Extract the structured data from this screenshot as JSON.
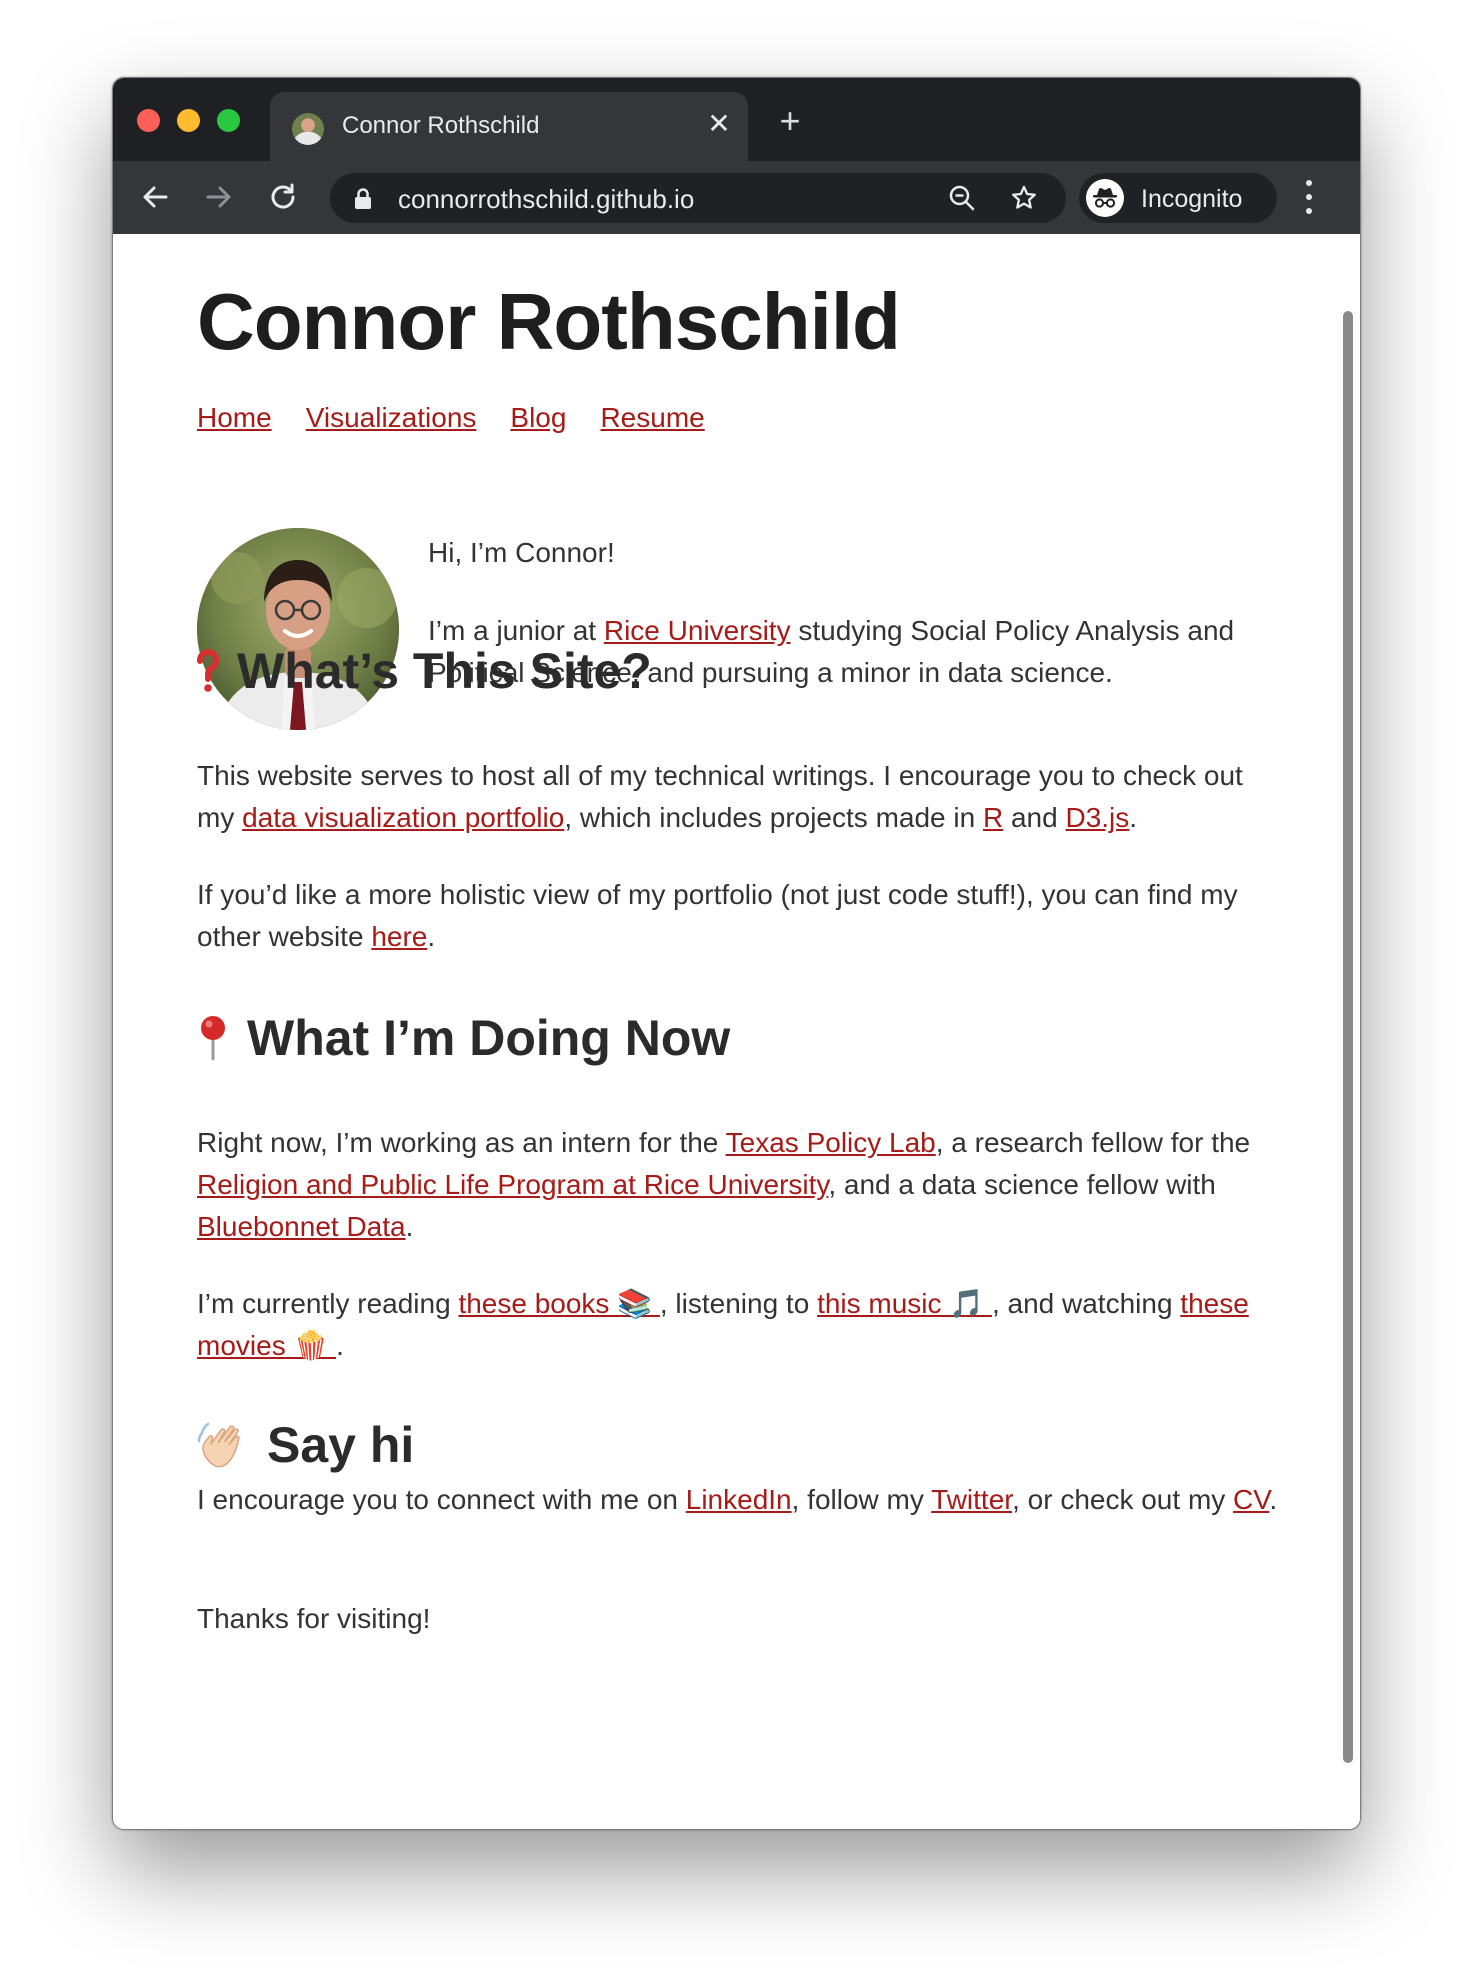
{
  "browser": {
    "tab_title": "Connor Rothschild",
    "url": "connorrothschild.github.io",
    "incognito_label": "Incognito"
  },
  "site": {
    "title": "Connor Rothschild",
    "nav": [
      "Home",
      "Visualizations",
      "Blog",
      "Resume"
    ]
  },
  "intro": {
    "greeting": "Hi, I’m Connor!",
    "line_pre": "I’m a junior at ",
    "rice_link": "Rice University",
    "line_post": " studying Social Policy Analysis and Political Science, and pursuing a minor in data science."
  },
  "section_site": {
    "heading": "What’s This Site?",
    "p1_pre": "This website serves to host all of my technical writings. I encourage you to check out my ",
    "p1_link_portfolio": "data visualization portfolio",
    "p1_mid": ", which includes projects made in ",
    "p1_link_r": "R",
    "p1_and": " and ",
    "p1_link_d3": "D3.js",
    "p1_end": ".",
    "p2_pre": "If you’d like a more holistic view of my portfolio (not just code stuff!), you can find my other website ",
    "p2_link": "here",
    "p2_end": "."
  },
  "section_now": {
    "heading": "What I’m Doing Now",
    "p1_pre": "Right now, I’m working as an intern for the ",
    "p1_link_tpl": "Texas Policy Lab",
    "p1_mid1": ", a research fellow for the ",
    "p1_link_rpl": "Religion and Public Life Program at Rice University",
    "p1_mid2": ", and a data science fellow with ",
    "p1_link_bb": "Bluebonnet Data",
    "p1_end": ".",
    "p2_pre": "I’m currently reading ",
    "p2_link_books": "these books 📚 ",
    "p2_mid1": ", listening to ",
    "p2_link_music": "this music 🎵 ",
    "p2_mid2": ", and watching ",
    "p2_link_movies": "these movies 🍿 ",
    "p2_end": "."
  },
  "section_hi": {
    "heading": "Say hi",
    "p1_pre": "I encourage you to connect with me on ",
    "p1_link_li": "LinkedIn",
    "p1_mid1": ", follow my ",
    "p1_link_tw": "Twitter",
    "p1_mid2": ", or check out my ",
    "p1_link_cv": "CV",
    "p1_end": ".",
    "p2": "Thanks for visiting!"
  },
  "colors": {
    "link": "#a61b17",
    "heading": "#2b2b2b",
    "chrome_dark": "#1f2024",
    "chrome_toolbar": "#35363a"
  },
  "icons": [
    "back-arrow-icon",
    "forward-arrow-icon",
    "reload-icon",
    "lock-icon",
    "zoom-out-icon",
    "star-icon",
    "incognito-icon",
    "kebab-menu-icon",
    "question-mark-icon",
    "pushpin-icon",
    "waving-hand-icon"
  ]
}
